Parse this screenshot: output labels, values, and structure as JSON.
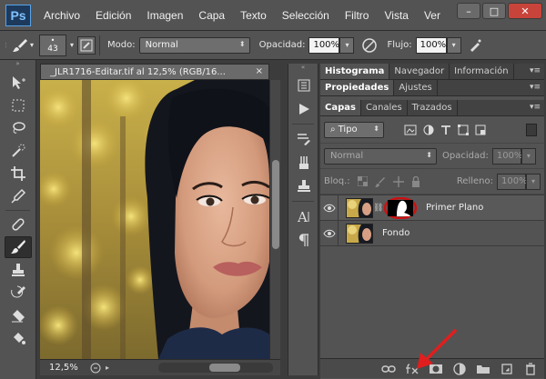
{
  "app": {
    "logo": "Ps"
  },
  "menu": [
    "Archivo",
    "Edición",
    "Imagen",
    "Capa",
    "Texto",
    "Selección",
    "Filtro",
    "Vista",
    "Ver"
  ],
  "window": {
    "minimize": "–",
    "maximize": "□",
    "close": "✕"
  },
  "options": {
    "brush_size": "43",
    "mode_label": "Modo:",
    "mode_value": "Normal",
    "opacity_label": "Opacidad:",
    "opacity_value": "100%",
    "flow_label": "Flujo:",
    "flow_value": "100%"
  },
  "document": {
    "tab_title": "_JLR1716-Editar.tif al 12,5% (RGB/16...",
    "close": "×",
    "zoom": "12,5%"
  },
  "panels": {
    "row1_tabs": [
      "Histograma",
      "Navegador",
      "Información"
    ],
    "row2_tabs": [
      "Propiedades",
      "Ajustes"
    ],
    "row3_tabs": [
      "Capas",
      "Canales",
      "Trazados"
    ],
    "filter_value": "Tipo",
    "blend_value": "Normal",
    "opacity_label": "Opacidad:",
    "opacity_value": "100%",
    "lock_label": "Bloq.:",
    "fill_label": "Relleno:",
    "fill_value": "100%",
    "layers": [
      {
        "name": "Primer Plano"
      },
      {
        "name": "Fondo"
      }
    ]
  },
  "colors": {
    "accent": "#cc1111",
    "arrow": "#e01e1e"
  }
}
